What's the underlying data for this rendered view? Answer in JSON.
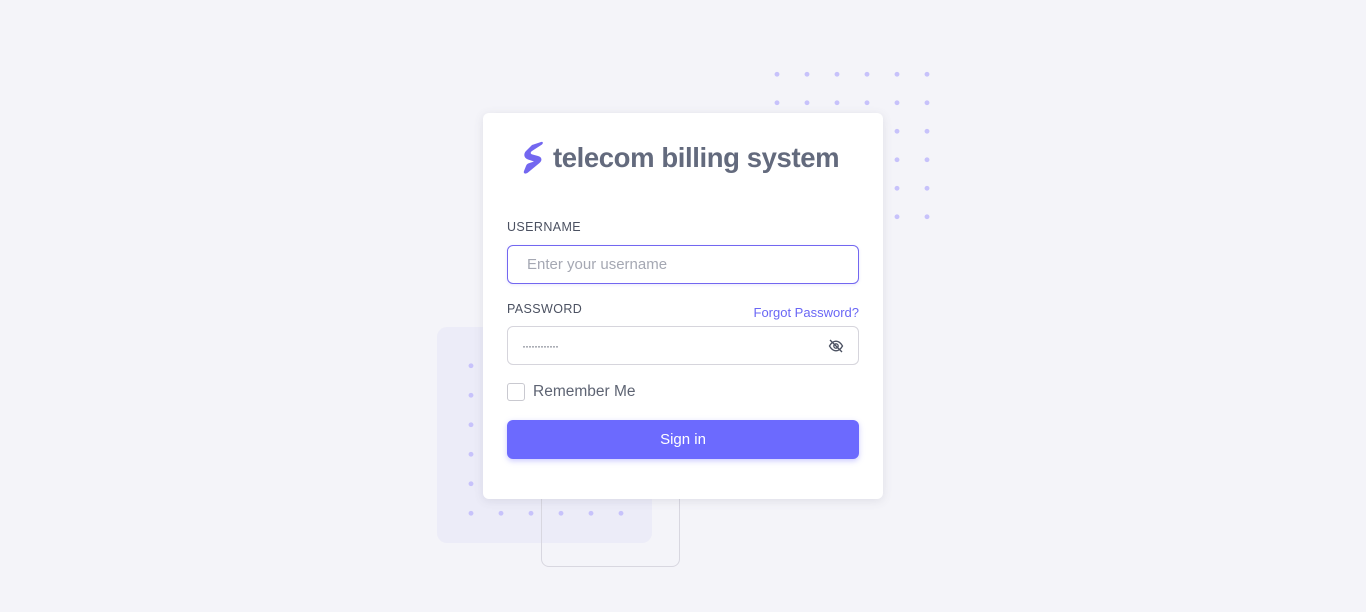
{
  "brand": {
    "name": "telecom billing system",
    "logo_icon": "brand-s-logo-icon",
    "accent_color": "#7367f0"
  },
  "form": {
    "username_label": "USERNAME",
    "username_placeholder": "Enter your username",
    "username_value": "",
    "password_label": "PASSWORD",
    "password_value": "············",
    "password_masked": true,
    "password_toggle_icon": "eye-off-icon",
    "forgot_password": "Forgot Password?",
    "remember_me_label": "Remember Me",
    "remember_me_checked": false,
    "submit_label": "Sign in"
  },
  "colors": {
    "background": "#f4f4f9",
    "button": "#6c6afe",
    "link": "#6a67f5"
  }
}
